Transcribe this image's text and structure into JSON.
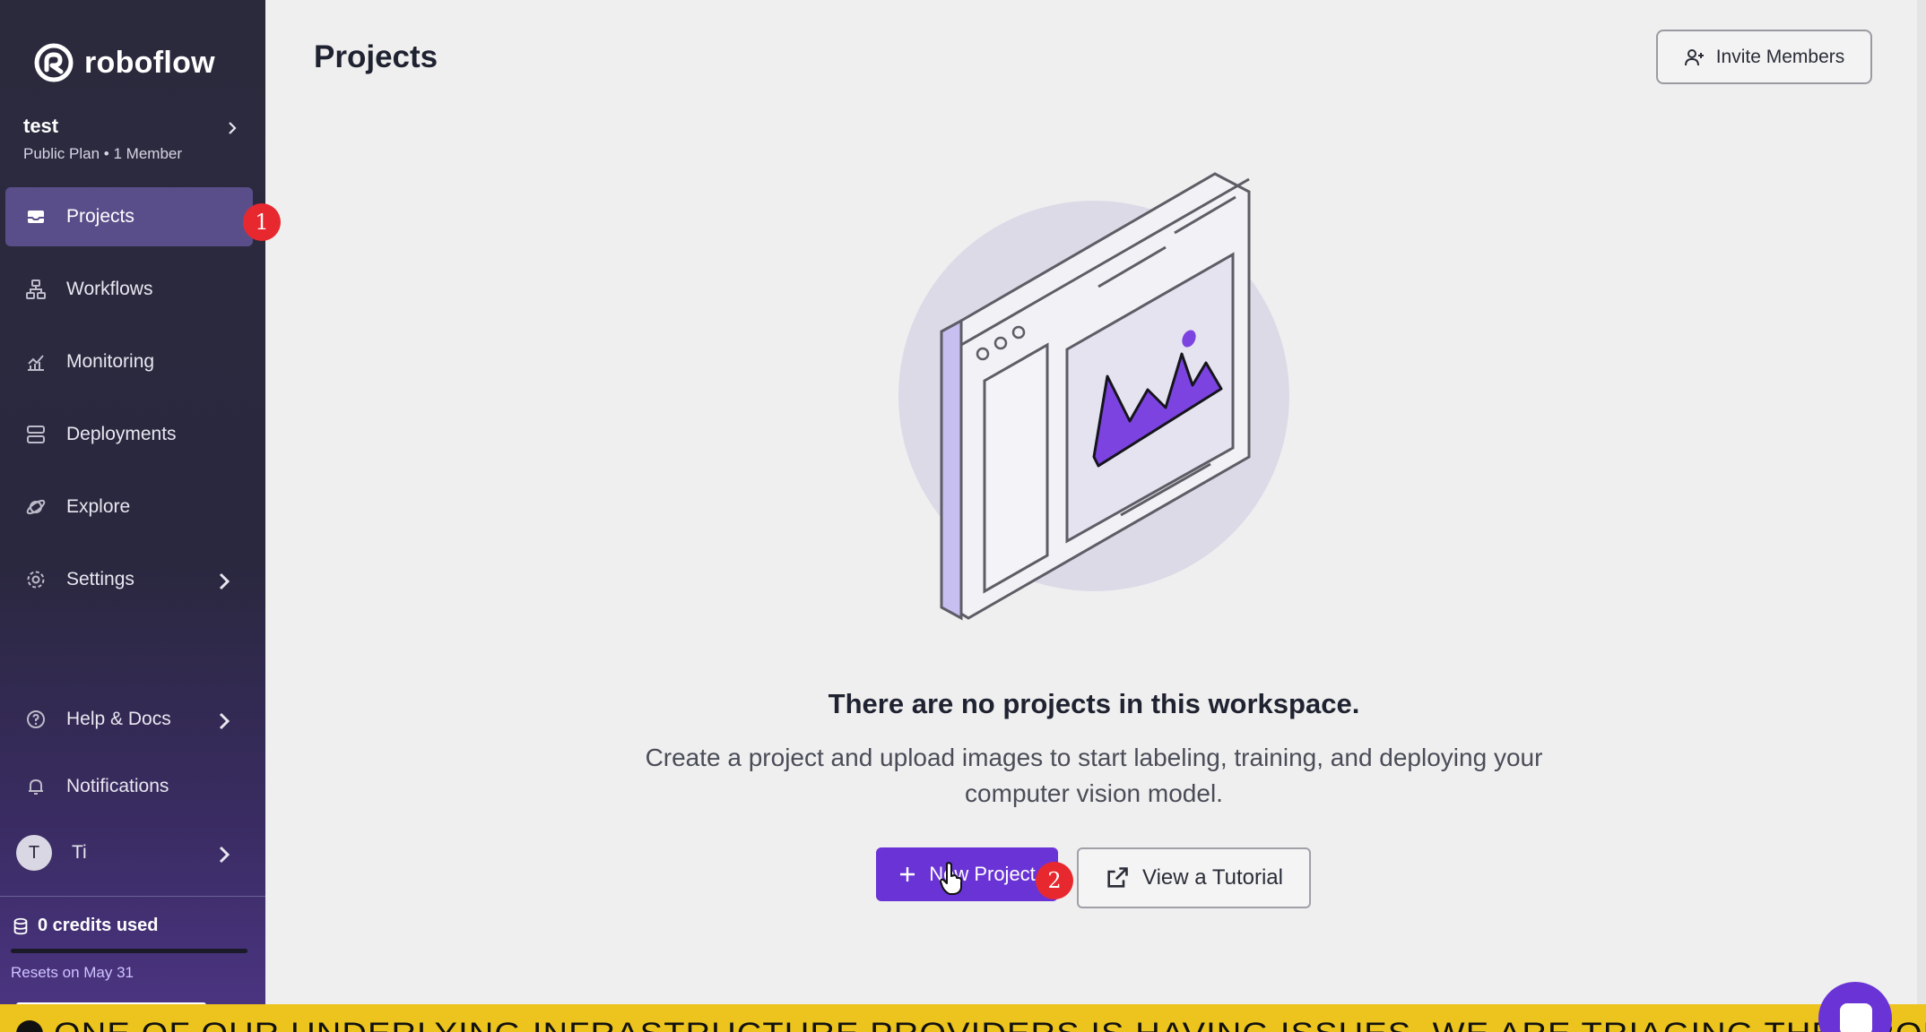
{
  "brand": {
    "name": "roboflow"
  },
  "workspace": {
    "name": "test",
    "plan": "Public Plan",
    "separator": "•",
    "members": "1 Member"
  },
  "nav": {
    "projects": "Projects",
    "workflows": "Workflows",
    "monitoring": "Monitoring",
    "deployments": "Deployments",
    "explore": "Explore",
    "settings": "Settings",
    "help": "Help & Docs",
    "notifications": "Notifications"
  },
  "user": {
    "initial": "T",
    "name": "Ti"
  },
  "credits": {
    "used_label": "0 credits used",
    "resets": "Resets on May 31",
    "used_fraction": 0
  },
  "annotations": {
    "step1": "1",
    "step2": "2"
  },
  "header": {
    "title": "Projects",
    "invite_label": "Invite Members"
  },
  "empty_state": {
    "title": "There are no projects in this workspace.",
    "description": "Create a project and upload images to start labeling, training, and deploying your computer vision model.",
    "new_project_label": "New Project",
    "tutorial_label": "View a Tutorial"
  },
  "banner": {
    "text": "ONE OF OUR UNDERLYING INFRASTRUCTURE PROVIDERS IS HAVING ISSUES. WE ARE TRIAGING THE PROBLEM. PLEASE CHECK THE STATUS"
  },
  "colors": {
    "accent": "#6a33d6",
    "sidebar": "#2b2a3d",
    "badge": "#e8282f",
    "banner": "#ecc41d"
  }
}
